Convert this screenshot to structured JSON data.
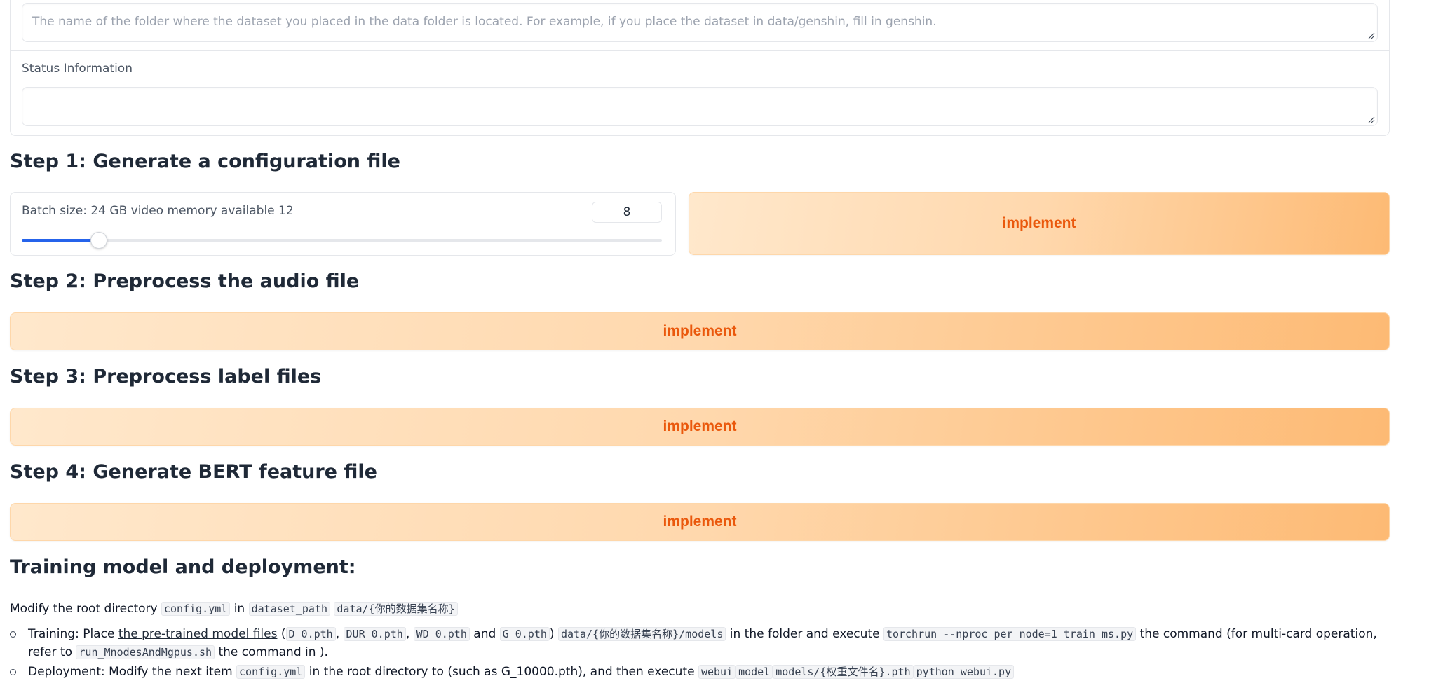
{
  "dataset": {
    "placeholder": "The name of the folder where the dataset you placed in the data folder is located. For example, if you place the dataset in data/genshin, fill in genshin."
  },
  "status": {
    "label": "Status Information",
    "value": ""
  },
  "step1": {
    "title": "Step 1: Generate a configuration file",
    "batch_label": "Batch size: 24 GB video memory available 12",
    "batch_value": "8",
    "slider_fraction": 0.12,
    "button": "implement"
  },
  "step2": {
    "title": "Step 2: Preprocess the audio file",
    "button": "implement"
  },
  "step3": {
    "title": "Step 3: Preprocess label files",
    "button": "implement"
  },
  "step4": {
    "title": "Step 4: Generate BERT feature file",
    "button": "implement"
  },
  "training": {
    "title": "Training model and deployment:",
    "line1": {
      "t1": "Modify the root directory",
      "c1": "config.yml",
      "t2": "in",
      "c2": "dataset_path",
      "c3": "data/{你的数据集名称}"
    },
    "item1": {
      "t1": "Training: Place",
      "link": "the pre-trained model files",
      "t2": "(",
      "c1": "D_0.pth",
      "t3": ",",
      "c2": "DUR_0.pth",
      "t4": ",",
      "c3": "WD_0.pth",
      "t5": "and",
      "c4": "G_0.pth",
      "t6": ")",
      "c5": "data/{你的数据集名称}/models",
      "t7": "in the folder and execute",
      "c6": "torchrun --nproc_per_node=1 train_ms.py",
      "t8": "the command (for multi-card operation, refer to",
      "c7": "run_MnodesAndMgpus.sh",
      "t9": "the command in )."
    },
    "item2": {
      "t1": "Deployment: Modify the next item",
      "c1": "config.yml",
      "t2": "in the root directory to (such as G_10000.pth), and then execute",
      "c2": "webui",
      "c3": "model",
      "c4": "models/{权重文件名}.pth",
      "c5": "python webui.py"
    }
  },
  "colors": {
    "accent_orange": "#ea580c",
    "button_gradient_start": "#ffe8cc",
    "button_gradient_end": "#fdba74",
    "slider_blue": "#2563eb"
  }
}
